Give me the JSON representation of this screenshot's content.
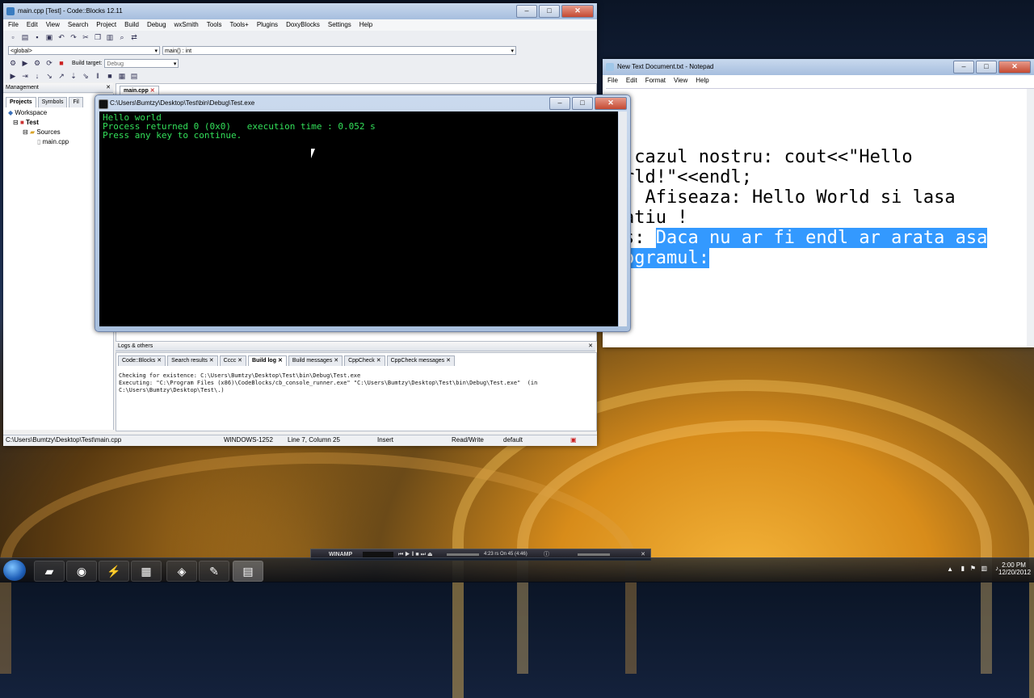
{
  "codeblocks": {
    "title": "main.cpp [Test] - Code::Blocks 12.11",
    "menu": [
      "File",
      "Edit",
      "View",
      "Search",
      "Project",
      "Build",
      "Debug",
      "wxSmith",
      "Tools",
      "Tools+",
      "Plugins",
      "DoxyBlocks",
      "Settings",
      "Help"
    ],
    "scope_combo": "<global>",
    "function_combo": "main() : int",
    "build_target_label": "Build target:",
    "build_target_value": "Debug",
    "management": {
      "title": "Management",
      "tabs": [
        "Projects",
        "Symbols",
        "Fil"
      ],
      "tree": [
        "Workspace",
        "Test",
        "Sources",
        "main.cpp"
      ]
    },
    "editor_tab": "main.cpp",
    "logs": {
      "title": "Logs & others",
      "tabs": [
        "Code::Blocks",
        "Search results",
        "Cccc",
        "Build log",
        "Build messages",
        "CppCheck",
        "CppCheck messages"
      ],
      "lines": [
        "Checking for existence: C:\\Users\\Bumtzy\\Desktop\\Test\\bin\\Debug\\Test.exe",
        "Executing: \"C:\\Program Files (x86)\\CodeBlocks/cb_console_runner.exe\" \"C:\\Users\\Bumtzy\\Desktop\\Test\\bin\\Debug\\Test.exe\"  (in",
        "C:\\Users\\Bumtzy\\Desktop\\Test\\.)"
      ]
    },
    "status": {
      "path": "C:\\Users\\Bumtzy\\Desktop\\Test\\main.cpp",
      "encoding": "WINDOWS-1252",
      "position": "Line 7, Column 25",
      "mode": "Insert",
      "access": "Read/Write",
      "lang": "default"
    }
  },
  "console": {
    "title": "C:\\Users\\Bumtzy\\Desktop\\Test\\bin\\Debug\\Test.exe",
    "lines": [
      "Hello world",
      "Process returned 0 (0x0)   execution time : 0.052 s",
      "Press any key to continue."
    ]
  },
  "notepad": {
    "title": "New Text Document.txt - Notepad",
    "menu": [
      "File",
      "Edit",
      "Format",
      "View",
      "Help"
    ],
    "lines": [
      " cazul nostru: cout<<\"Hello",
      "rld!\"<<endl;",
      "  Afiseaza: Hello World si lasa",
      "atiu !",
      "",
      "s: "
    ],
    "selected_1": "Daca nu ar fi endl ar arata asa",
    "selected_2": "ogramul:"
  },
  "winamp": {
    "label": "WINAMP",
    "track": "4:23  rs On 45 (4:46)"
  },
  "tray": {
    "time": "2:00 PM",
    "date": "12/20/2012"
  }
}
